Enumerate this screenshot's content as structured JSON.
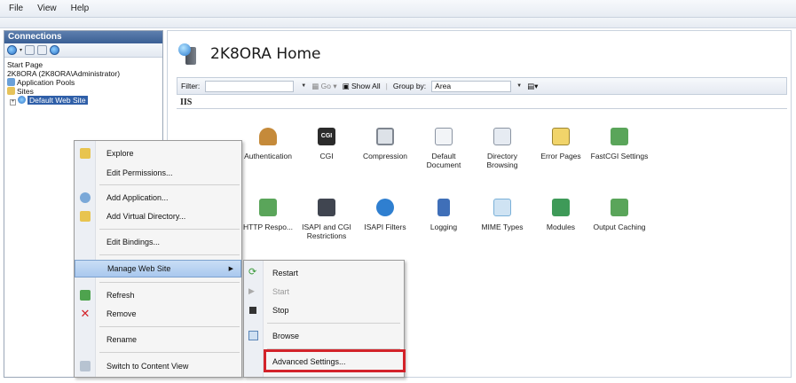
{
  "menubar": {
    "items": [
      "File",
      "View",
      "Help"
    ]
  },
  "connections": {
    "title": "Connections",
    "tree": {
      "start_page": "Start Page",
      "server": "2K8ORA (2K8ORA\\Administrator)",
      "app_pools": "Application Pools",
      "sites": "Sites",
      "default_site": "Default Web Site"
    }
  },
  "main": {
    "title": "2K8ORA Home",
    "filter_label": "Filter:",
    "go_label": "Go",
    "show_all_label": "Show All",
    "group_by_label": "Group by:",
    "group_by_value": "Area",
    "section": "IIS",
    "features": [
      {
        "label": "Authentication",
        "color": "#c58a3a"
      },
      {
        "label": "CGI",
        "color": "#2b2b2b"
      },
      {
        "label": "Compression",
        "color": "#9aa0a8"
      },
      {
        "label": "Default Document",
        "color": "#dfe6ee"
      },
      {
        "label": "Directory Browsing",
        "color": "#cfd8e4"
      },
      {
        "label": "Error Pages",
        "color": "#e8c04a"
      },
      {
        "label": "FastCGI Settings",
        "color": "#5aa55a"
      },
      {
        "label": "HTTP Respo...",
        "color": "#5aa55a"
      },
      {
        "label": "ISAPI and CGI Restrictions",
        "color": "#404550"
      },
      {
        "label": "ISAPI Filters",
        "color": "#2f7fd0"
      },
      {
        "label": "Logging",
        "color": "#3f6fb8"
      },
      {
        "label": "MIME Types",
        "color": "#7ab0d8"
      },
      {
        "label": "Modules",
        "color": "#3e9a58"
      },
      {
        "label": "Output Caching",
        "color": "#5aa55a"
      }
    ]
  },
  "context_menu": {
    "explore": "Explore",
    "edit_permissions": "Edit Permissions...",
    "add_application": "Add Application...",
    "add_virtual_directory": "Add Virtual Directory...",
    "edit_bindings": "Edit Bindings...",
    "manage_web_site": "Manage Web Site",
    "refresh": "Refresh",
    "remove": "Remove",
    "rename": "Rename",
    "switch_content_view": "Switch to Content View"
  },
  "submenu": {
    "restart": "Restart",
    "start": "Start",
    "stop": "Stop",
    "browse": "Browse",
    "advanced_settings": "Advanced Settings..."
  },
  "colors": {
    "highlight": "#d3232a",
    "selection": "#2f5fa8"
  }
}
